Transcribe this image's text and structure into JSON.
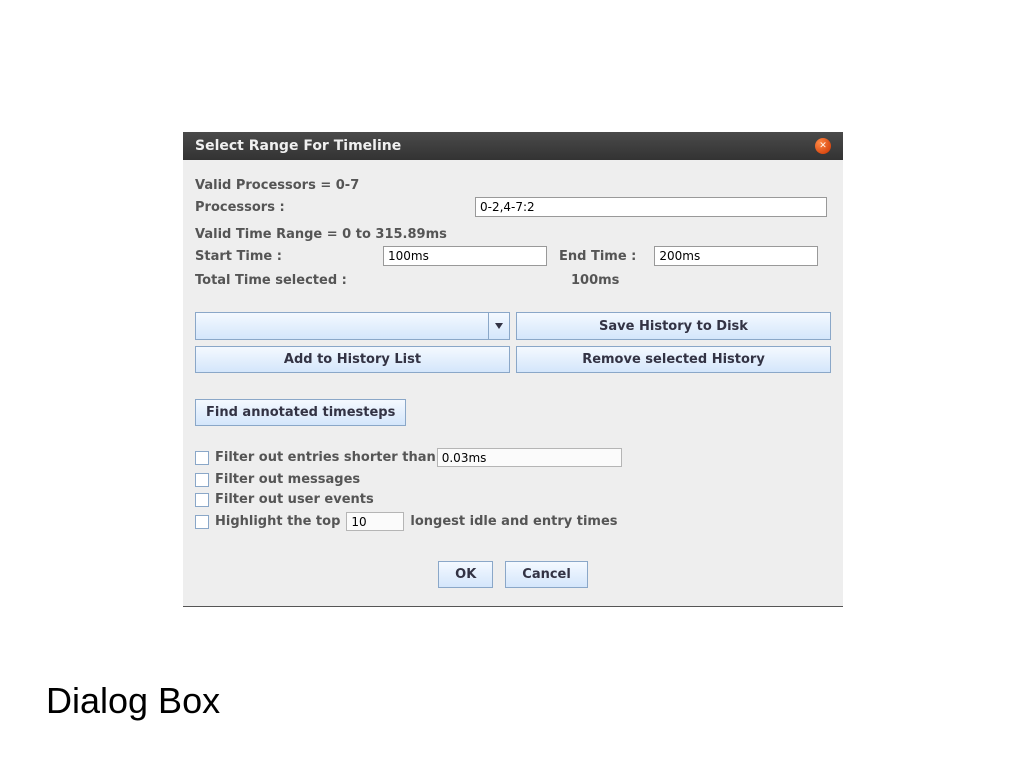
{
  "dialog": {
    "title": "Select Range For Timeline",
    "valid_processors_label": "Valid Processors = 0-7",
    "processors_label": "Processors :",
    "processors_value": "0-2,4-7:2",
    "valid_time_label": "Valid Time Range = 0 to 315.89ms",
    "start_label": "Start Time :",
    "start_value": "100ms",
    "end_label": "End Time :",
    "end_value": "200ms",
    "total_label": "Total Time selected :",
    "total_value": "100ms",
    "history_dropdown_value": "",
    "save_history_label": "Save History to Disk",
    "add_history_label": "Add to History List",
    "remove_history_label": "Remove selected History",
    "find_annotated_label": "Find annotated timesteps",
    "checkboxes": {
      "filter_short_label": "Filter out entries shorter than",
      "filter_short_value": "0.03ms",
      "filter_messages_label": "Filter out messages",
      "filter_user_events_label": "Filter out user events",
      "highlight_pre_label": "Highlight the top",
      "highlight_value": "10",
      "highlight_post_label": "longest idle and entry times"
    },
    "ok_label": "OK",
    "cancel_label": "Cancel"
  },
  "page_caption": "Dialog Box"
}
